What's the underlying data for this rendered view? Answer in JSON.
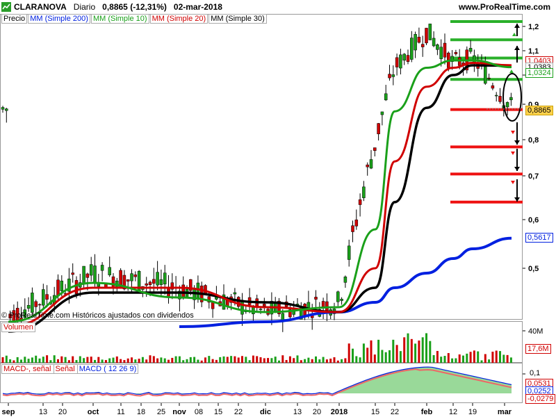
{
  "header": {
    "symbol": "CLARANOVA",
    "period": "Diario",
    "last": "0,8865 (-12,31%)",
    "date": "02-mar-2018",
    "site": "www.ProRealTime.com"
  },
  "legend": {
    "price": "Precio",
    "ma200": "MM (Simple 200)",
    "ma10": "MM (Simple 10)",
    "ma20": "MM (Simple 20)",
    "ma30": "MM (Simple 30)"
  },
  "copyright": "© ProRealTime.com Históricos ajustados con dividendos",
  "volume_label": "Volumen",
  "macd_labels": {
    "signal_line": "MACD-, señal",
    "signal": "Señal",
    "macd": "MACD ( 12 26 9)"
  },
  "price_tags": {
    "t1": "1,0403",
    "t2": "1,0383",
    "t3": "1,0324",
    "last": "0,8865",
    "ma200": "0,5617"
  },
  "vol_tags": {
    "max": "40M",
    "cur": "17,6M"
  },
  "macd_tags": {
    "tick": "0,1",
    "v1": "0,0531",
    "v2": "0,0252",
    "v3": "-0,0279"
  },
  "colors": {
    "ma200": "#0020e0",
    "ma10": "#1aa01a",
    "ma20": "#d00000",
    "ma30": "#000000",
    "up": "#1aa01a",
    "down": "#d00000"
  },
  "chart_data": {
    "type": "line",
    "title": "CLARANOVA Diario",
    "y_axis_ticks": [
      "1,2",
      "1,1",
      "1",
      "0,9",
      "0,8",
      "0,7",
      "0,6",
      "0,5"
    ],
    "x_axis_ticks": [
      "sep",
      "13",
      "20",
      "oct",
      "11",
      "18",
      "25",
      "nov",
      "08",
      "15",
      "22",
      "dic",
      "13",
      "20",
      "2018",
      "15",
      "22",
      "feb",
      "12",
      "19",
      "mar"
    ],
    "resistance_levels": [
      1.22,
      1.145,
      1.07,
      0.985
    ],
    "support_levels": [
      0.885,
      0.78,
      0.705,
      0.64
    ],
    "series": [
      {
        "name": "Precio",
        "x": [
          "sep",
          "oct",
          "nov",
          "dic",
          "2018",
          "15",
          "22",
          "feb",
          "12",
          "19",
          "mar"
        ],
        "values": [
          0.4,
          0.49,
          0.46,
          0.41,
          0.43,
          0.79,
          1.03,
          1.18,
          1.05,
          1.07,
          0.8865
        ]
      },
      {
        "name": "MM (Simple 10)",
        "x": [
          "sep",
          "oct",
          "nov",
          "dic",
          "2018",
          "15",
          "22",
          "feb",
          "12",
          "19",
          "mar"
        ],
        "values": [
          0.39,
          0.47,
          0.44,
          0.41,
          0.42,
          0.58,
          0.88,
          1.03,
          1.06,
          1.06,
          1.0324
        ]
      },
      {
        "name": "MM (Simple 20)",
        "x": [
          "sep",
          "oct",
          "nov",
          "dic",
          "2018",
          "15",
          "22",
          "feb",
          "12",
          "19",
          "mar"
        ],
        "values": [
          0.38,
          0.46,
          0.46,
          0.42,
          0.41,
          0.5,
          0.74,
          0.96,
          1.03,
          1.05,
          1.0403
        ]
      },
      {
        "name": "MM (Simple 30)",
        "x": [
          "sep",
          "oct",
          "nov",
          "dic",
          "2018",
          "15",
          "22",
          "feb",
          "12",
          "19",
          "mar"
        ],
        "values": [
          0.37,
          0.45,
          0.45,
          0.43,
          0.41,
          0.46,
          0.64,
          0.89,
          1.0,
          1.04,
          1.0383
        ]
      },
      {
        "name": "MM (Simple 200)",
        "x": [
          "nov",
          "dic",
          "2018",
          "15",
          "22",
          "feb",
          "12",
          "19",
          "mar"
        ],
        "values": [
          0.38,
          0.39,
          0.41,
          0.43,
          0.46,
          0.49,
          0.52,
          0.54,
          0.5617
        ]
      }
    ]
  }
}
